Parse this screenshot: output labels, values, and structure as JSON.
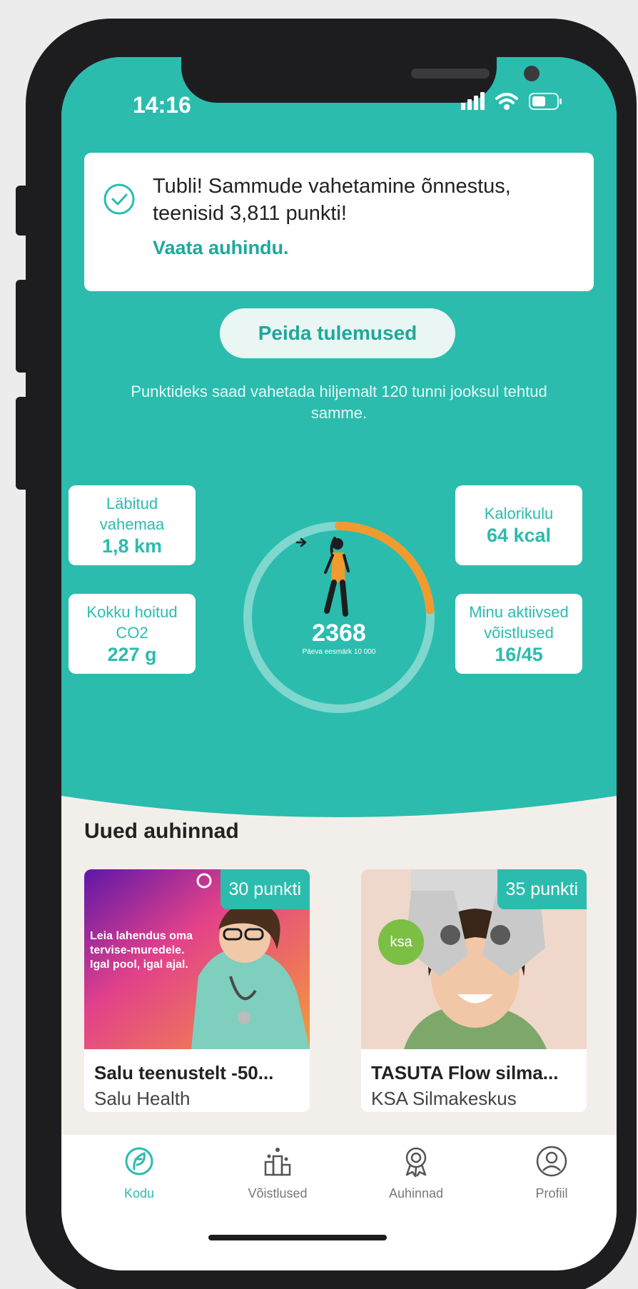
{
  "status_bar": {
    "time": "14:16"
  },
  "toast": {
    "message": "Tubli! Sammude vahetamine õnnestus, teenisid 3,811 punkti!",
    "link": "Vaata auhindu."
  },
  "hide_button": "Peida tulemused",
  "info_text": "Punktideks saad vahetada hiljemalt 120 tunni jooksul tehtud samme.",
  "stats": {
    "distance": {
      "label": "Läbitud vahemaa",
      "value": "1,8 km"
    },
    "calories": {
      "label": "Kalorikulu",
      "value": "64 kcal"
    },
    "co2": {
      "label": "Kokku hoitud CO2",
      "value": "227 g"
    },
    "competitions": {
      "label": "Minu aktiivsed võistlused",
      "value": "16/45"
    }
  },
  "steps": {
    "count": "2368",
    "goal_label": "Päeva eesmärk 10 000",
    "progress": 0.2368
  },
  "rewards": {
    "title": "Uued auhinnad",
    "items": [
      {
        "badge": "30 punkti",
        "title": "Salu teenustelt -50...",
        "provider": "Salu Health",
        "image_text": "Leia lahendus oma tervise-muredele. Igal pool, igal ajal."
      },
      {
        "badge": "35 punkti",
        "title": "TASUTA Flow silma...",
        "provider": "KSA Silmakeskus",
        "logo_text": "ksa"
      }
    ]
  },
  "tabs": [
    {
      "label": "Kodu",
      "icon": "home-leaf-icon",
      "active": true
    },
    {
      "label": "Võistlused",
      "icon": "podium-icon",
      "active": false
    },
    {
      "label": "Auhinnad",
      "icon": "award-icon",
      "active": false
    },
    {
      "label": "Profiil",
      "icon": "profile-icon",
      "active": false
    }
  ],
  "colors": {
    "brand": "#2bbcae",
    "progress": "#f19a2e",
    "background": "#f2efea"
  }
}
